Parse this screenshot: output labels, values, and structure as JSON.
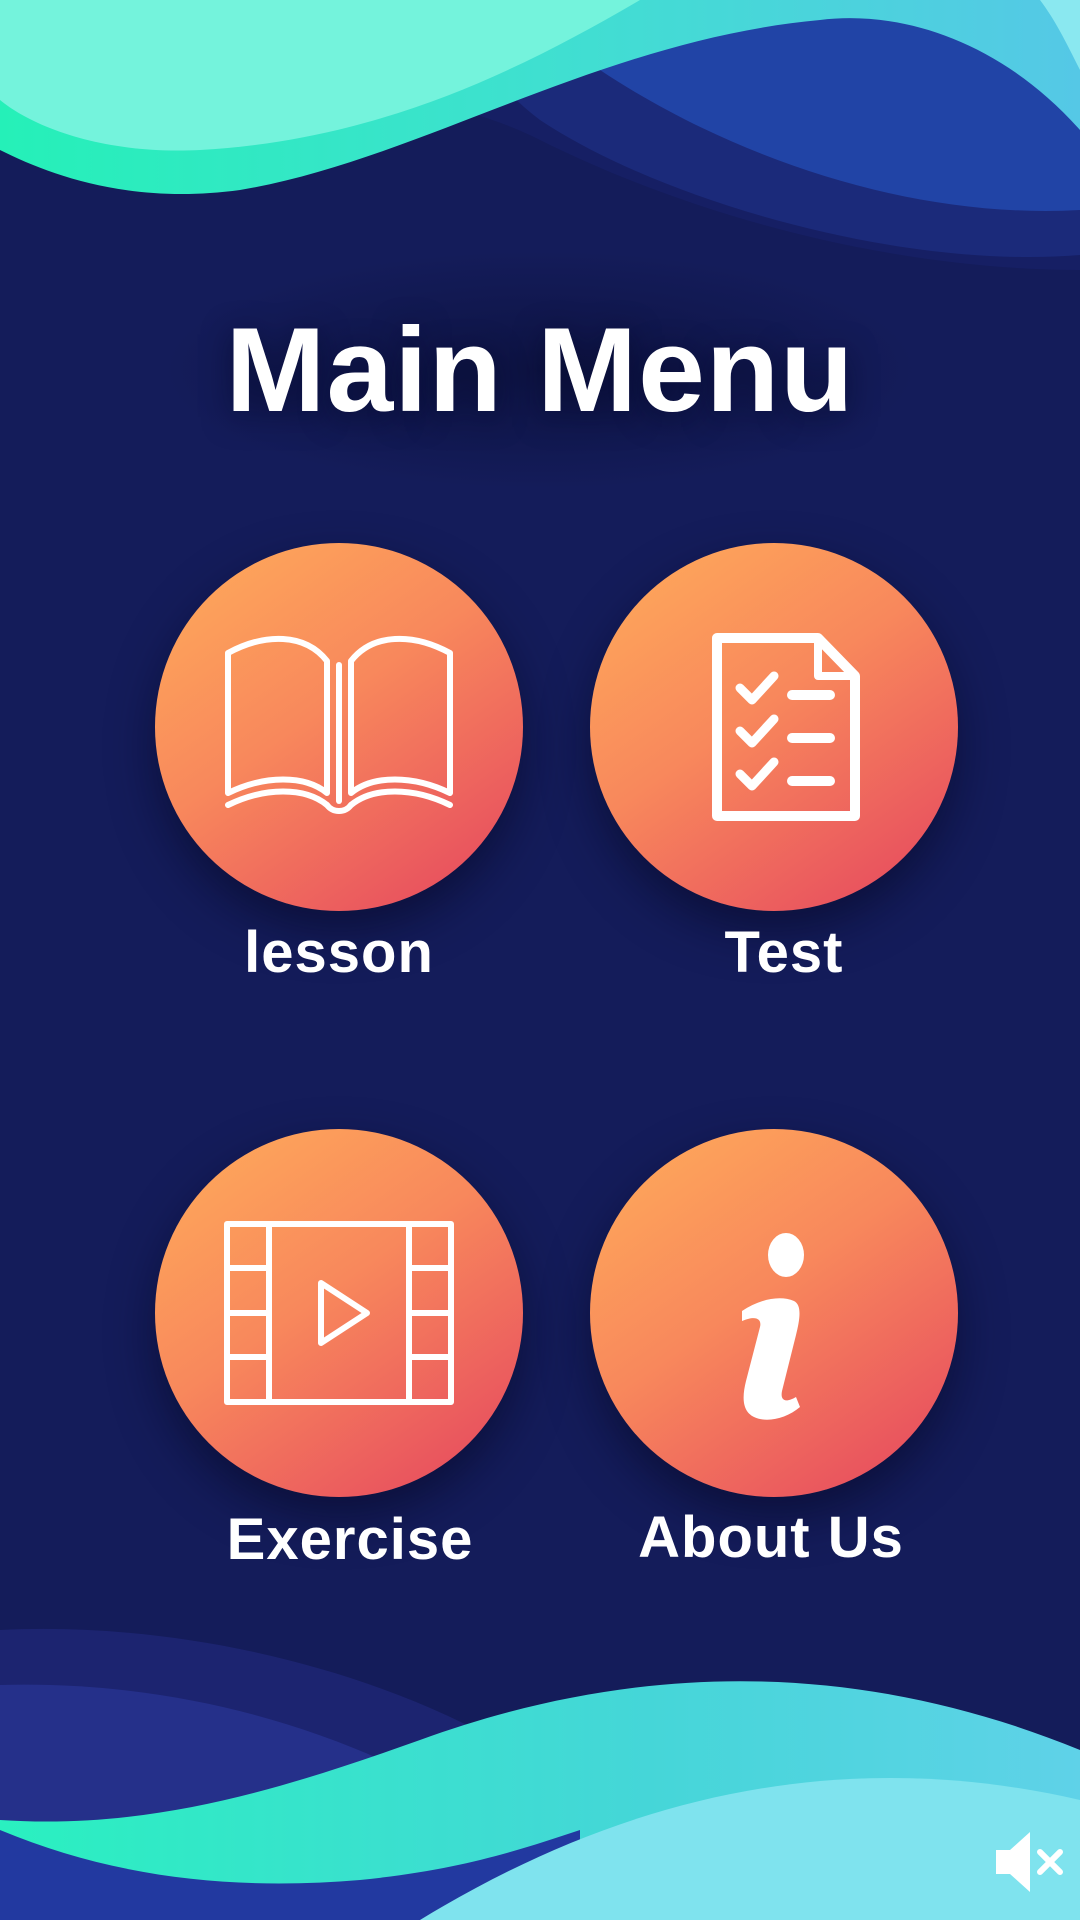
{
  "title": "Main Menu",
  "menu": {
    "lesson": {
      "label": "lesson",
      "icon": "open-book-icon"
    },
    "test": {
      "label": "Test",
      "icon": "checklist-document-icon"
    },
    "exercise": {
      "label": "Exercise",
      "icon": "video-play-film-icon"
    },
    "about": {
      "label": "About Us",
      "icon": "info-icon"
    }
  },
  "sound": {
    "icon": "speaker-muted-icon",
    "state": "muted"
  },
  "colors": {
    "background": "#141c5a",
    "button_gradient_start": "#ffad5a",
    "button_gradient_end": "#e4435f",
    "wave_mint": "#2ee8bf",
    "wave_cyan": "#45d3dc",
    "wave_blue": "#2144a6"
  }
}
